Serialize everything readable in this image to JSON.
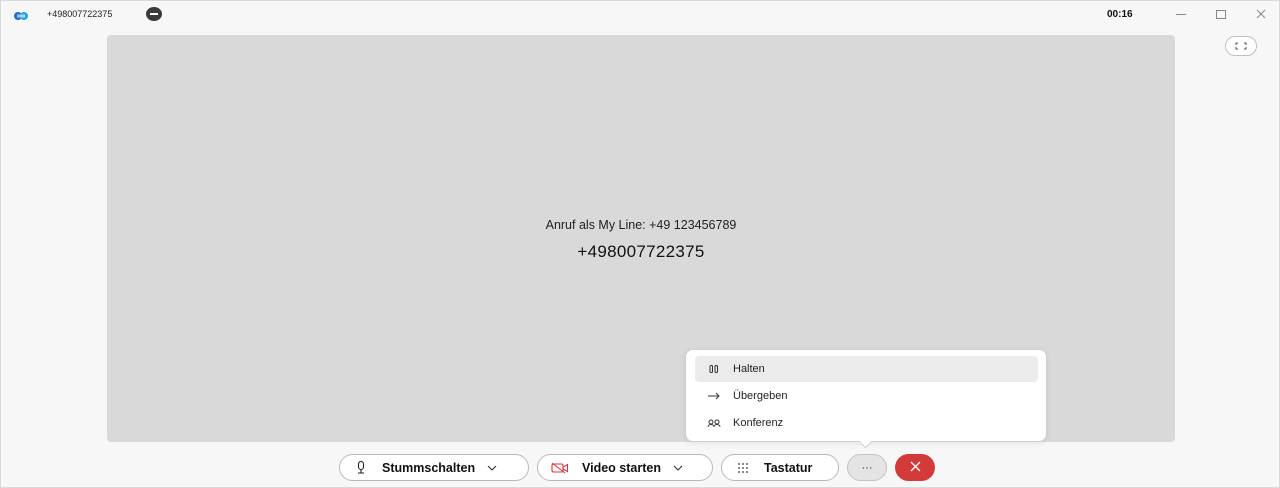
{
  "titlebar": {
    "number": "+498007722375",
    "timer": "00:16",
    "icons": [
      "app-logo-icon",
      "status-icon",
      "minimize-icon",
      "maximize-icon",
      "close-icon"
    ]
  },
  "stage": {
    "caller_line": "Anruf als My Line: +49 123456789",
    "caller_number": "+498007722375"
  },
  "more_menu": {
    "items": [
      {
        "label": "Halten",
        "icon": "pause-icon"
      },
      {
        "label": "Übergeben",
        "icon": "arrow-right-icon"
      },
      {
        "label": "Konferenz",
        "icon": "conference-icon"
      }
    ]
  },
  "controls": {
    "mute_label": "Stummschalten",
    "video_label": "Video starten",
    "keypad_label": "Tastatur",
    "more_label": "···"
  },
  "colors": {
    "end_call": "#d33a3a",
    "video_off_icon": "#d33a3a",
    "stage_bg": "#d9d9d9"
  }
}
